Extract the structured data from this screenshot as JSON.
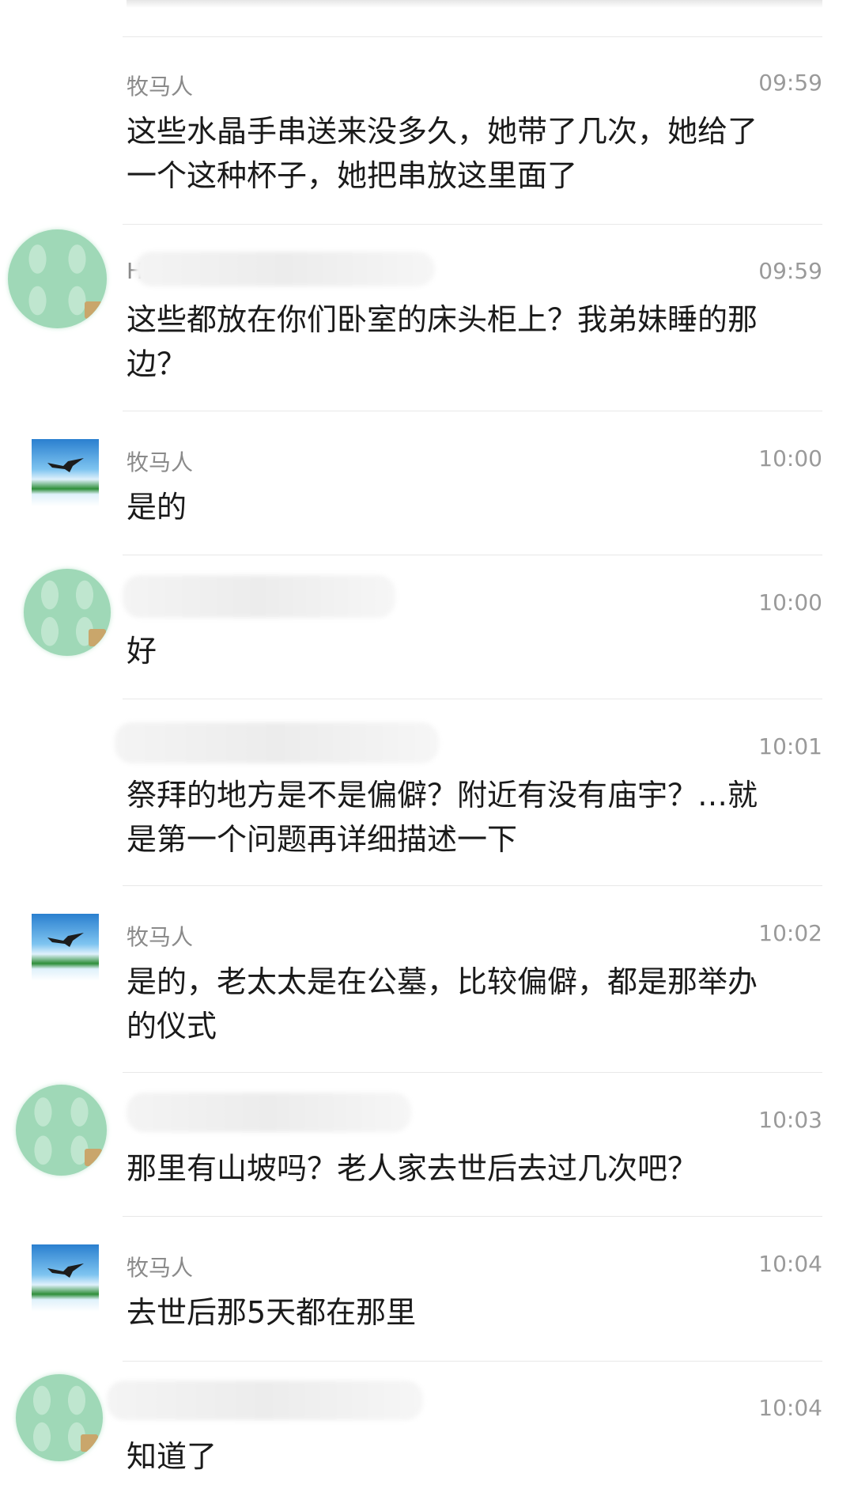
{
  "messages": [
    {
      "sender": "牧马人",
      "time": "09:59",
      "lines": [
        "这些水晶手串送来没多久，她带了几次，她给了",
        "一个这种杯子，她把串放这里面了"
      ]
    },
    {
      "sender": "H",
      "time": "09:59",
      "lines": [
        "这些都放在你们卧室的床头柜上？我弟妹睡的那",
        "边？"
      ]
    },
    {
      "sender": "牧马人",
      "time": "10:00",
      "lines": [
        "是的"
      ]
    },
    {
      "sender": "",
      "time": "10:00",
      "lines": [
        "好"
      ]
    },
    {
      "sender": "",
      "time": "10:01",
      "lines": [
        "祭拜的地方是不是偏僻？附近有没有庙宇？…就",
        "是第一个问题再详细描述一下"
      ]
    },
    {
      "sender": "牧马人",
      "time": "10:02",
      "lines": [
        "是的，老太太是在公墓，比较偏僻，都是那举办",
        "的仪式"
      ]
    },
    {
      "sender": "",
      "time": "10:03",
      "lines": [
        "那里有山坡吗？老人家去世后去过几次吧？"
      ]
    },
    {
      "sender": "牧马人",
      "time": "10:04",
      "lines": [
        "去世后那5天都在那里"
      ]
    },
    {
      "sender": "",
      "time": "10:04",
      "lines": [
        "知道了"
      ]
    }
  ]
}
